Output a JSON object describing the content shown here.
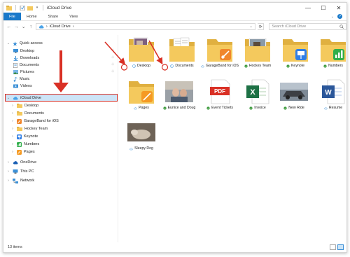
{
  "window": {
    "title": "iCloud Drive",
    "minimize_symbol": "—",
    "maximize_symbol": "☐",
    "close_symbol": "✕"
  },
  "ribbon": {
    "tabs": [
      "File",
      "Home",
      "Share",
      "View"
    ],
    "collapse_symbol": "⌄",
    "help_symbol": "?"
  },
  "navigation": {
    "back": "←",
    "forward": "→",
    "recent": "⌄",
    "up": "↑"
  },
  "address": {
    "separator": "›",
    "path": "iCloud Drive",
    "dropdown": "⌄",
    "refresh": "⟳"
  },
  "search": {
    "placeholder": "Search iCloud Drive",
    "icon": "search-icon"
  },
  "sidebar": {
    "quick_access": "Quick access",
    "quick_items": [
      {
        "label": "Desktop",
        "icon": "desktop-icon"
      },
      {
        "label": "Downloads",
        "icon": "downloads-icon"
      },
      {
        "label": "Documents",
        "icon": "documents-icon"
      },
      {
        "label": "Pictures",
        "icon": "pictures-icon"
      },
      {
        "label": "Music",
        "icon": "music-icon"
      },
      {
        "label": "Videos",
        "icon": "videos-icon"
      }
    ],
    "pin_symbol": "⊹",
    "icloud_drive": "iCloud Drive",
    "icloud_items": [
      "Desktop",
      "Documents",
      "GarageBand for iOS",
      "Hockey Team",
      "Keynote",
      "Numbers",
      "Pages"
    ],
    "onedrive": "OneDrive",
    "this_pc": "This PC",
    "network": "Network"
  },
  "files": [
    {
      "name": "Desktop",
      "type": "folder-photo",
      "status": "sync-pending"
    },
    {
      "name": "Documents",
      "type": "folder-docs",
      "status": "sync-pending"
    },
    {
      "name": "GarageBand for iOS",
      "type": "folder-garageband",
      "status": "cloud"
    },
    {
      "name": "Hockey Team",
      "type": "folder-photo",
      "status": "synced"
    },
    {
      "name": "Keynote",
      "type": "folder-keynote",
      "status": "synced"
    },
    {
      "name": "Numbers",
      "type": "folder-numbers",
      "status": "synced"
    },
    {
      "name": "Pages",
      "type": "folder-pages",
      "status": "cloud"
    },
    {
      "name": "Eunice and Doug",
      "type": "photo",
      "status": "synced"
    },
    {
      "name": "Event Tickets",
      "type": "pdf",
      "status": "synced",
      "badge": "PDF"
    },
    {
      "name": "Invoice",
      "type": "excel",
      "status": "synced",
      "badge": "X"
    },
    {
      "name": "New Ride",
      "type": "photo",
      "status": "synced"
    },
    {
      "name": "Resume",
      "type": "word",
      "status": "cloud",
      "badge": "W"
    },
    {
      "name": "Sleepy Dog",
      "type": "photo",
      "status": "cloud"
    }
  ],
  "status_bar": {
    "count": "13 items"
  },
  "colors": {
    "accent": "#1979ca",
    "highlight_red": "#d93025",
    "folder": "#f4c95d",
    "synced": "#3c9a3c",
    "selection": "#cce4f7"
  }
}
